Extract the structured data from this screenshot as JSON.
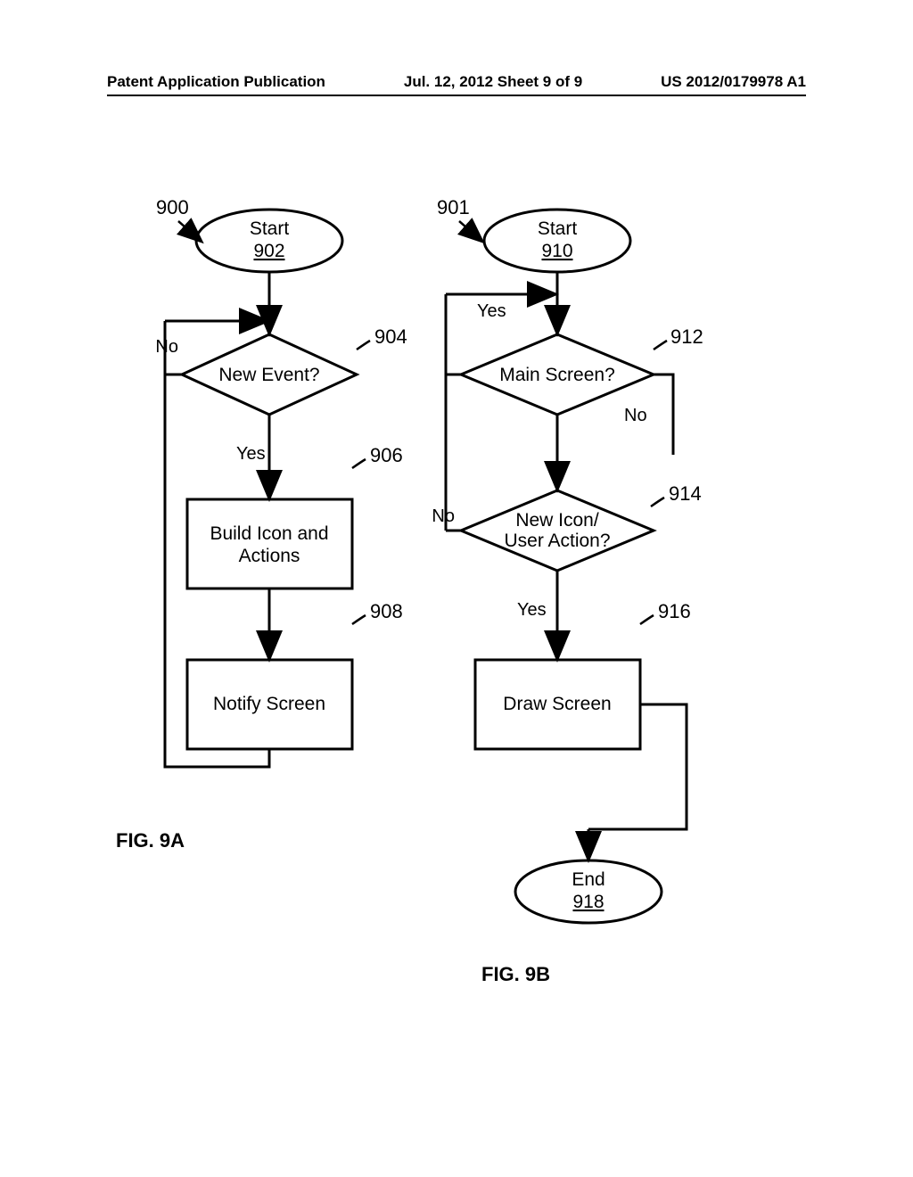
{
  "header": {
    "left": "Patent Application Publication",
    "center": "Jul. 12, 2012  Sheet 9 of 9",
    "right": "US 2012/0179978 A1"
  },
  "flowchart_a": {
    "id": "900",
    "start": {
      "label": "Start",
      "ref": "902"
    },
    "decision": {
      "label": "New Event?",
      "ref": "904",
      "yes": "Yes",
      "no": "No"
    },
    "process1": {
      "label1": "Build Icon and",
      "label2": "Actions",
      "ref": "906"
    },
    "process2": {
      "label": "Notify Screen",
      "ref": "908"
    },
    "caption": "FIG.  9A"
  },
  "flowchart_b": {
    "id": "901",
    "start": {
      "label": "Start",
      "ref": "910"
    },
    "decision1": {
      "label": "Main Screen?",
      "ref": "912",
      "yes": "Yes",
      "no": "No"
    },
    "decision2": {
      "label1": "New Icon/",
      "label2": "User Action?",
      "ref": "914",
      "yes": "Yes",
      "no": "No"
    },
    "process": {
      "label": "Draw Screen",
      "ref": "916"
    },
    "end": {
      "label": "End",
      "ref": "918"
    },
    "caption": "FIG.  9B"
  }
}
